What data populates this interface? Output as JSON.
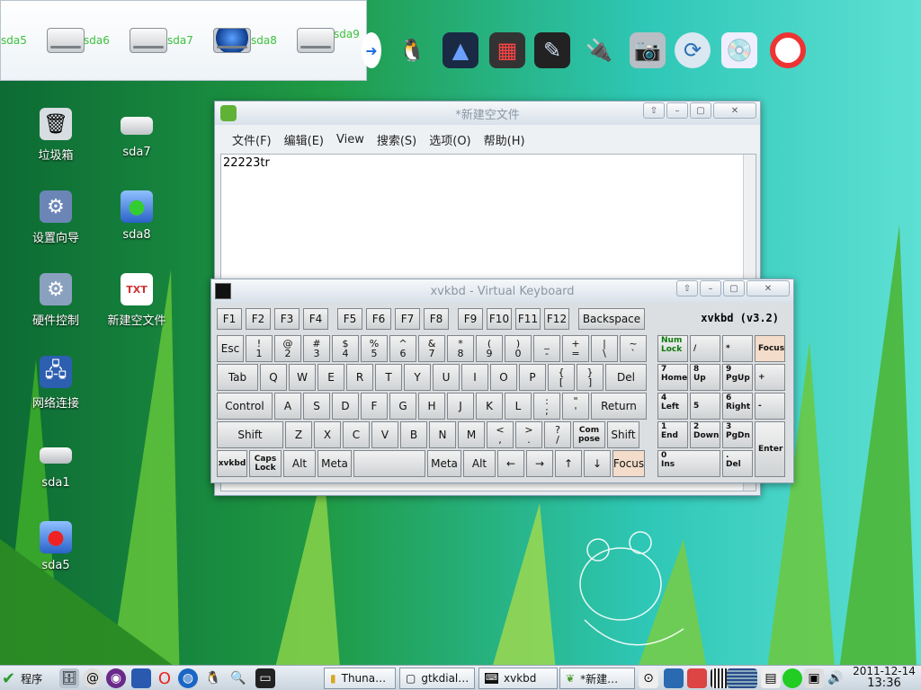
{
  "drives": [
    {
      "label": "sda5",
      "icon": "drive-icon"
    },
    {
      "label": "sda6",
      "icon": "drive-icon"
    },
    {
      "label": "sda7",
      "icon": "drive-icon"
    },
    {
      "label": "sda8",
      "icon": "globe-drive-icon"
    },
    {
      "label": "sda9",
      "icon": "drive-icon"
    }
  ],
  "dock_icons": [
    "arrow-icon",
    "qq-penguin-icon",
    "inkscape-icon",
    "image-viewer-icon",
    "paint-icon",
    "usb-drive-icon",
    "camera-icon",
    "refresh-icon",
    "dvd-icon",
    "lifebuoy-icon"
  ],
  "desktop": [
    {
      "label": "垃圾箱",
      "icon": "trash-icon"
    },
    {
      "label": "sda7",
      "icon": "drive-icon"
    },
    {
      "label": "设置向导",
      "icon": "settings-wizard-icon"
    },
    {
      "label": "sda8",
      "icon": "drive-icon"
    },
    {
      "label": "硬件控制",
      "icon": "hardware-icon"
    },
    {
      "label": "新建空文件",
      "icon": "txt-file-icon"
    },
    {
      "label": "网络连接",
      "icon": "network-icon"
    },
    {
      "label": "sda1",
      "icon": "drive-icon"
    },
    {
      "label": "sda5",
      "icon": "drive-icon"
    }
  ],
  "editor": {
    "title": "*新建空文件",
    "menu": [
      "文件(F)",
      "编辑(E)",
      "View",
      "搜索(S)",
      "选项(O)",
      "帮助(H)"
    ],
    "text": "22223tr"
  },
  "keyboard": {
    "title": "xvkbd - Virtual Keyboard",
    "version": "xvkbd (v3.2)",
    "fkeys": [
      "F1",
      "F2",
      "F3",
      "F4",
      "F5",
      "F6",
      "F7",
      "F8",
      "F9",
      "F10",
      "F11",
      "F12",
      "Backspace"
    ],
    "row1": [
      [
        "Esc",
        ""
      ],
      [
        "!",
        "1"
      ],
      [
        "@",
        "2"
      ],
      [
        "#",
        "3"
      ],
      [
        "$",
        "4"
      ],
      [
        "%",
        "5"
      ],
      [
        "^",
        "6"
      ],
      [
        "&",
        "7"
      ],
      [
        "*",
        "8"
      ],
      [
        "(",
        "9"
      ],
      [
        ")",
        "0"
      ],
      [
        "_",
        "-"
      ],
      [
        "+",
        "="
      ],
      [
        "|",
        "\\"
      ],
      [
        "~",
        "`"
      ]
    ],
    "row2": [
      "Tab",
      "Q",
      "W",
      "E",
      "R",
      "T",
      "Y",
      "U",
      "I",
      "O",
      "P",
      "{|[",
      "}|]",
      "Del"
    ],
    "row3": [
      "Control",
      "A",
      "S",
      "D",
      "F",
      "G",
      "H",
      "J",
      "K",
      "L",
      ":|;",
      "\"|'",
      "Return"
    ],
    "row4": [
      "Shift",
      "Z",
      "X",
      "C",
      "V",
      "B",
      "N",
      "M",
      "<|,",
      ">|.",
      "?|/",
      "Com|pose",
      "Shift"
    ],
    "row5": [
      "xvkbd",
      "Caps|Lock",
      "Alt",
      "Meta",
      "",
      "Meta",
      "Alt",
      "←",
      "→",
      "↑",
      "↓",
      "Focus"
    ],
    "numpad": [
      "Num|Lock",
      "/",
      "*",
      "Focus",
      "7|Home",
      "8|Up",
      "9|PgUp",
      "+",
      "4|Left",
      "5",
      "6|Right",
      "-",
      "1|End",
      "2|Down",
      "3|PgDn",
      "Enter",
      "0|Ins",
      ".|Del"
    ]
  },
  "taskbar": {
    "start_label": "程序",
    "tasks": [
      "Thuna…",
      "gtkdial…",
      "xvkbd",
      "*新建…"
    ],
    "date": "2011-12-14",
    "time": "13:36"
  },
  "colors": {
    "accent": "#3cc13c",
    "focus_key": "#f3dcc9"
  }
}
